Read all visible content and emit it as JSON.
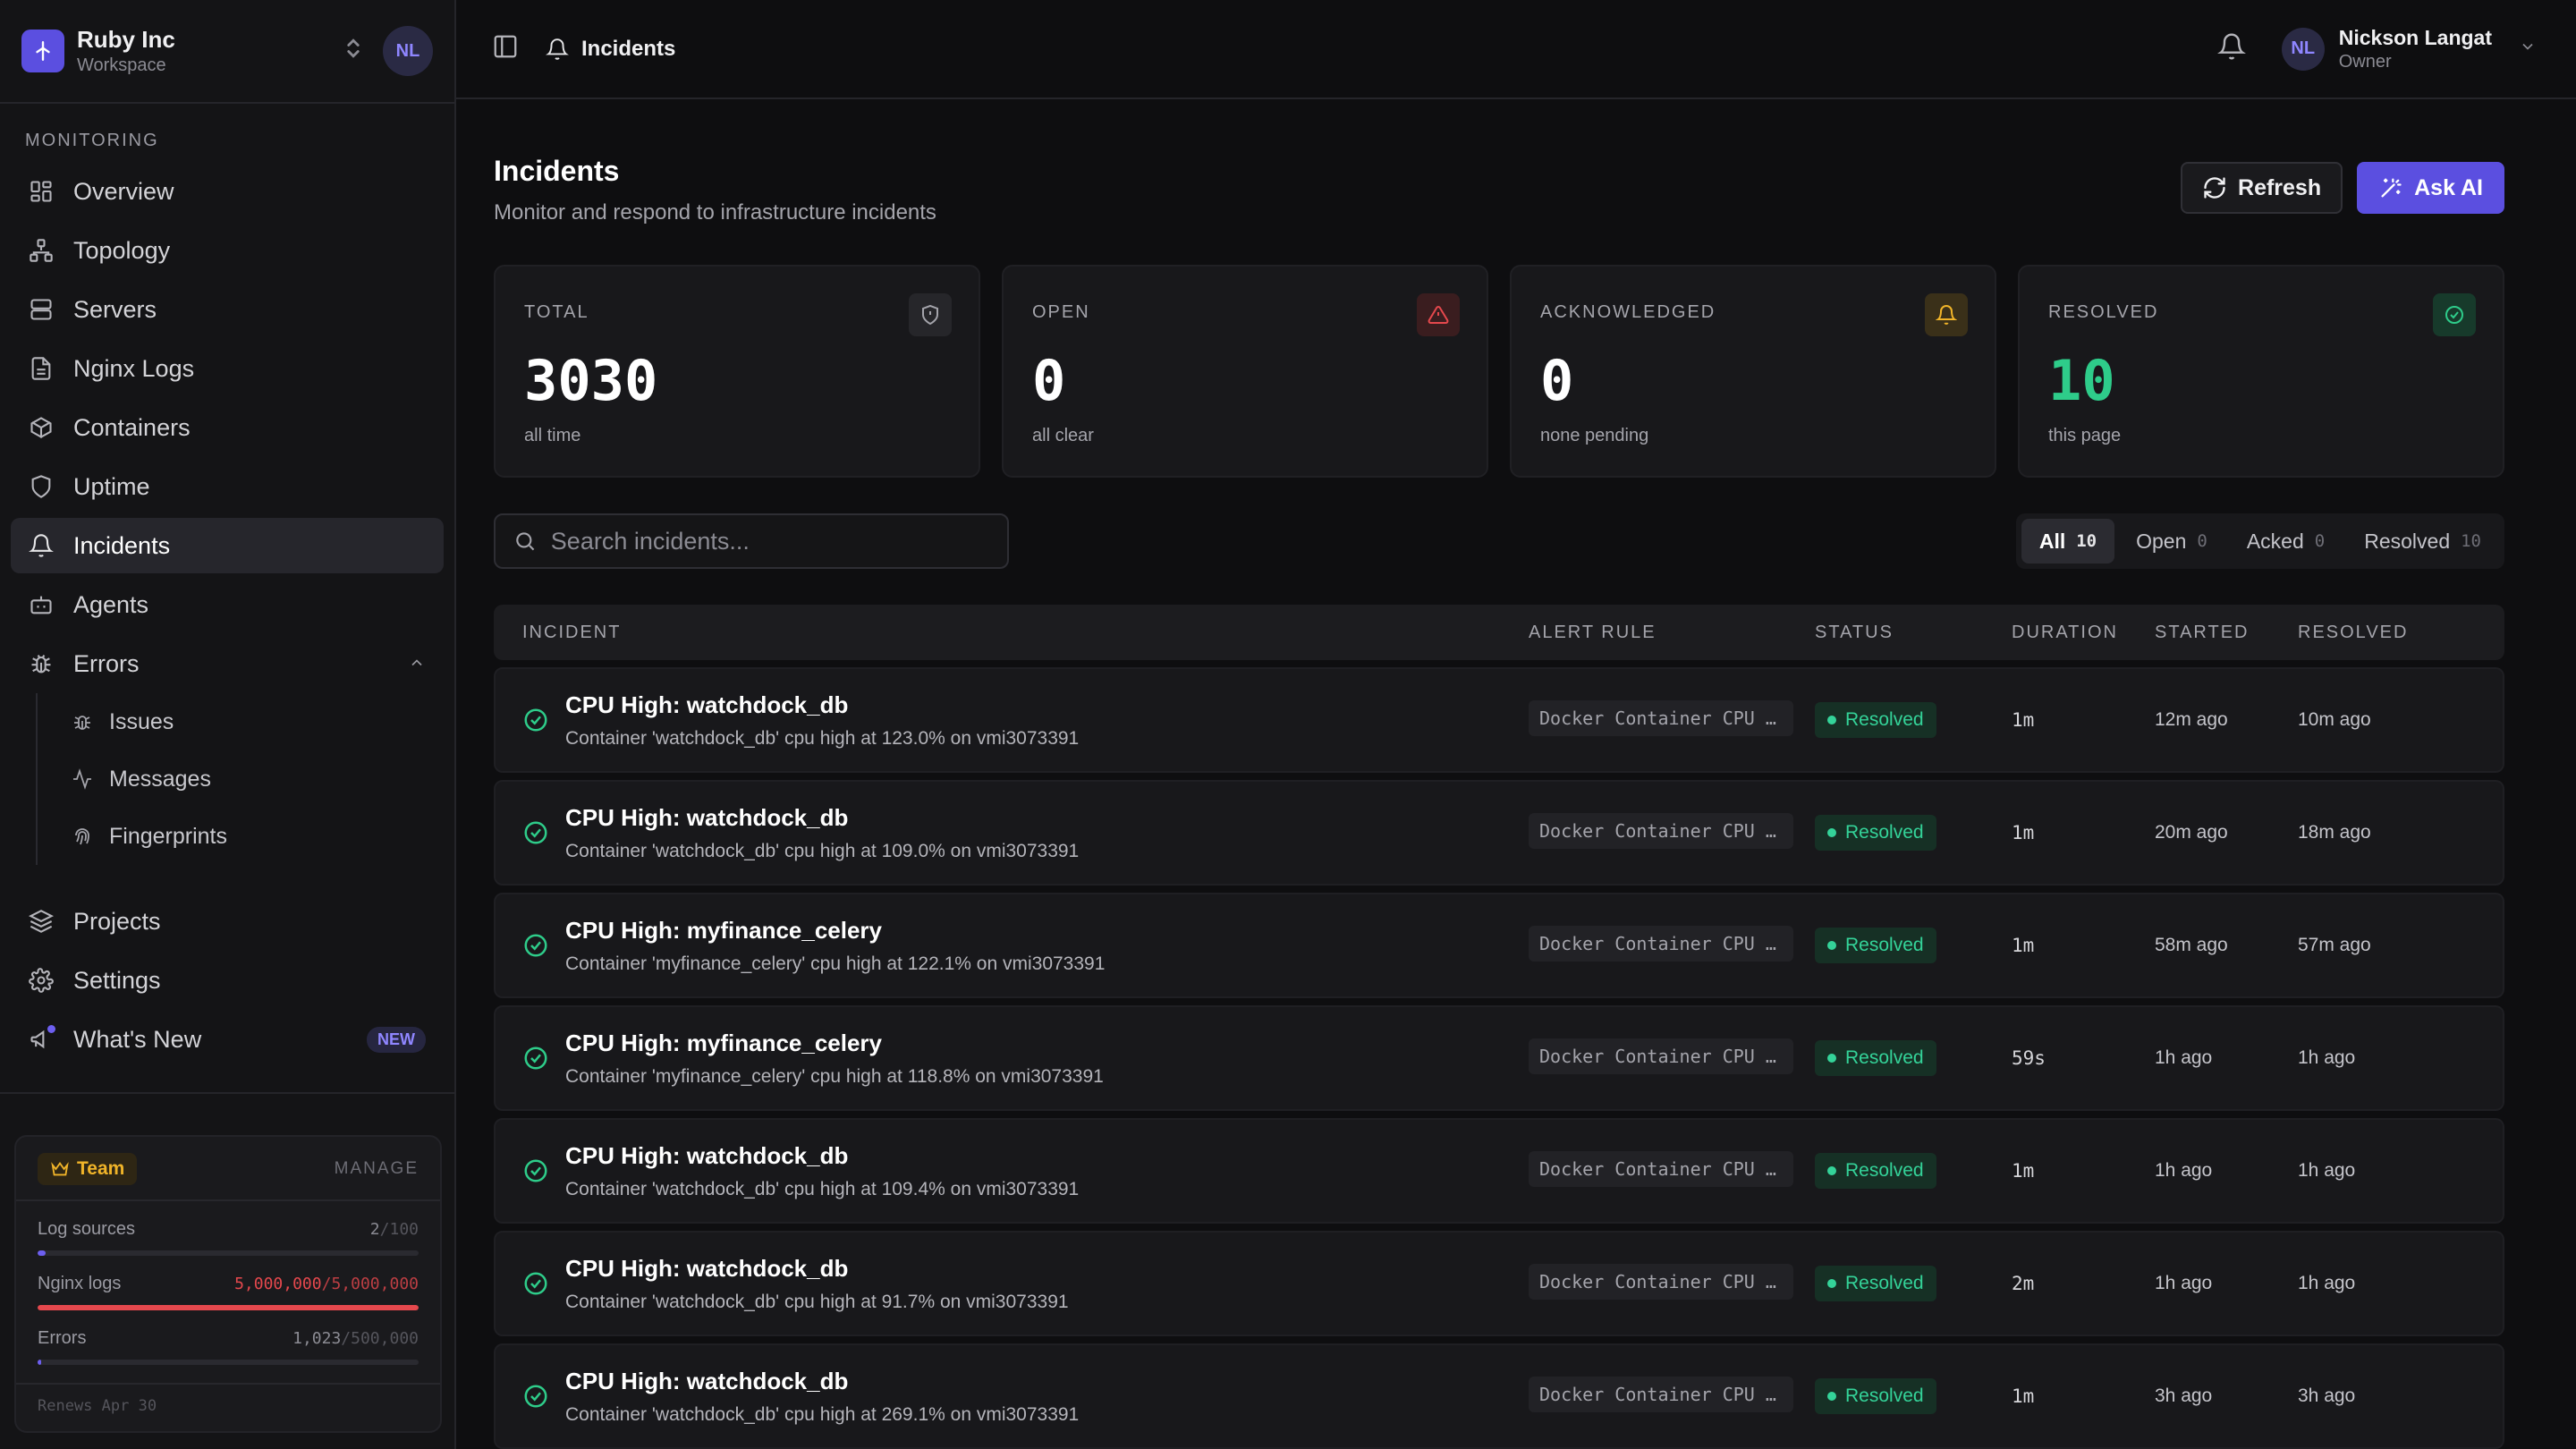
{
  "workspace": {
    "name": "Ruby Inc",
    "sub": "Workspace",
    "initials": "NL"
  },
  "nav": {
    "section": "MONITORING",
    "items": [
      {
        "label": "Overview"
      },
      {
        "label": "Topology"
      },
      {
        "label": "Servers"
      },
      {
        "label": "Nginx Logs"
      },
      {
        "label": "Containers"
      },
      {
        "label": "Uptime"
      },
      {
        "label": "Incidents"
      },
      {
        "label": "Agents"
      },
      {
        "label": "Errors"
      }
    ],
    "sub_items": [
      {
        "label": "Issues"
      },
      {
        "label": "Messages"
      },
      {
        "label": "Fingerprints"
      }
    ],
    "bottom_items": [
      {
        "label": "Projects"
      },
      {
        "label": "Settings"
      },
      {
        "label": "What's New",
        "badge": "NEW"
      }
    ]
  },
  "plan": {
    "team_label": "Team",
    "manage_label": "MANAGE",
    "quotas": [
      {
        "label": "Log sources",
        "current": "2",
        "limit": "/100",
        "fill": 0.02,
        "color": "#6d5ff0"
      },
      {
        "label": "Nginx logs",
        "current": "5,000,000",
        "limit": "/5,000,000",
        "fill": 1.0,
        "color": "#e5484d"
      },
      {
        "label": "Errors",
        "current": "1,023",
        "limit": "/500,000",
        "fill": 0.002,
        "color": "#6d5ff0"
      }
    ],
    "renews": "Renews Apr 30"
  },
  "topbar": {
    "crumb": "Incidents",
    "user": {
      "name": "Nickson Langat",
      "role": "Owner",
      "initials": "NL"
    }
  },
  "page": {
    "title": "Incidents",
    "subtitle": "Monitor and respond to infrastructure incidents",
    "refresh_label": "Refresh",
    "ask_ai_label": "Ask AI"
  },
  "stats": [
    {
      "label": "TOTAL",
      "value": "3030",
      "note": "all time",
      "icon_color": "#a4a4ab",
      "icon_bg": "#26262a"
    },
    {
      "label": "OPEN",
      "value": "0",
      "note": "all clear",
      "icon_color": "#e5484d",
      "icon_bg": "#3a1d1f"
    },
    {
      "label": "ACKNOWLEDGED",
      "value": "0",
      "note": "none pending",
      "icon_color": "#f0b429",
      "icon_bg": "#3a3019"
    },
    {
      "label": "RESOLVED",
      "value": "10",
      "note": "this page",
      "icon_color": "#2ecc8a",
      "icon_bg": "#173a2b"
    }
  ],
  "search": {
    "placeholder": "Search incidents..."
  },
  "tabs": [
    {
      "label": "All",
      "count": "10"
    },
    {
      "label": "Open",
      "count": "0"
    },
    {
      "label": "Acked",
      "count": "0"
    },
    {
      "label": "Resolved",
      "count": "10"
    }
  ],
  "table": {
    "headers": {
      "incident": "INCIDENT",
      "rule": "ALERT RULE",
      "status": "STATUS",
      "duration": "DURATION",
      "started": "STARTED",
      "resolved": "RESOLVED"
    },
    "rows": [
      {
        "title": "CPU High: watchdock_db",
        "desc": "Container 'watchdock_db' cpu high at 123.0% on vmi3073391",
        "rule": "Docker Container CPU …",
        "status": "Resolved",
        "duration": "1m",
        "started": "12m ago",
        "resolved": "10m ago"
      },
      {
        "title": "CPU High: watchdock_db",
        "desc": "Container 'watchdock_db' cpu high at 109.0% on vmi3073391",
        "rule": "Docker Container CPU …",
        "status": "Resolved",
        "duration": "1m",
        "started": "20m ago",
        "resolved": "18m ago"
      },
      {
        "title": "CPU High: myfinance_celery",
        "desc": "Container 'myfinance_celery' cpu high at 122.1% on vmi3073391",
        "rule": "Docker Container CPU …",
        "status": "Resolved",
        "duration": "1m",
        "started": "58m ago",
        "resolved": "57m ago"
      },
      {
        "title": "CPU High: myfinance_celery",
        "desc": "Container 'myfinance_celery' cpu high at 118.8% on vmi3073391",
        "rule": "Docker Container CPU …",
        "status": "Resolved",
        "duration": "59s",
        "started": "1h ago",
        "resolved": "1h ago"
      },
      {
        "title": "CPU High: watchdock_db",
        "desc": "Container 'watchdock_db' cpu high at 109.4% on vmi3073391",
        "rule": "Docker Container CPU …",
        "status": "Resolved",
        "duration": "1m",
        "started": "1h ago",
        "resolved": "1h ago"
      },
      {
        "title": "CPU High: watchdock_db",
        "desc": "Container 'watchdock_db' cpu high at 91.7% on vmi3073391",
        "rule": "Docker Container CPU …",
        "status": "Resolved",
        "duration": "2m",
        "started": "1h ago",
        "resolved": "1h ago"
      },
      {
        "title": "CPU High: watchdock_db",
        "desc": "Container 'watchdock_db' cpu high at 269.1% on vmi3073391",
        "rule": "Docker Container CPU …",
        "status": "Resolved",
        "duration": "1m",
        "started": "3h ago",
        "resolved": "3h ago"
      }
    ]
  }
}
